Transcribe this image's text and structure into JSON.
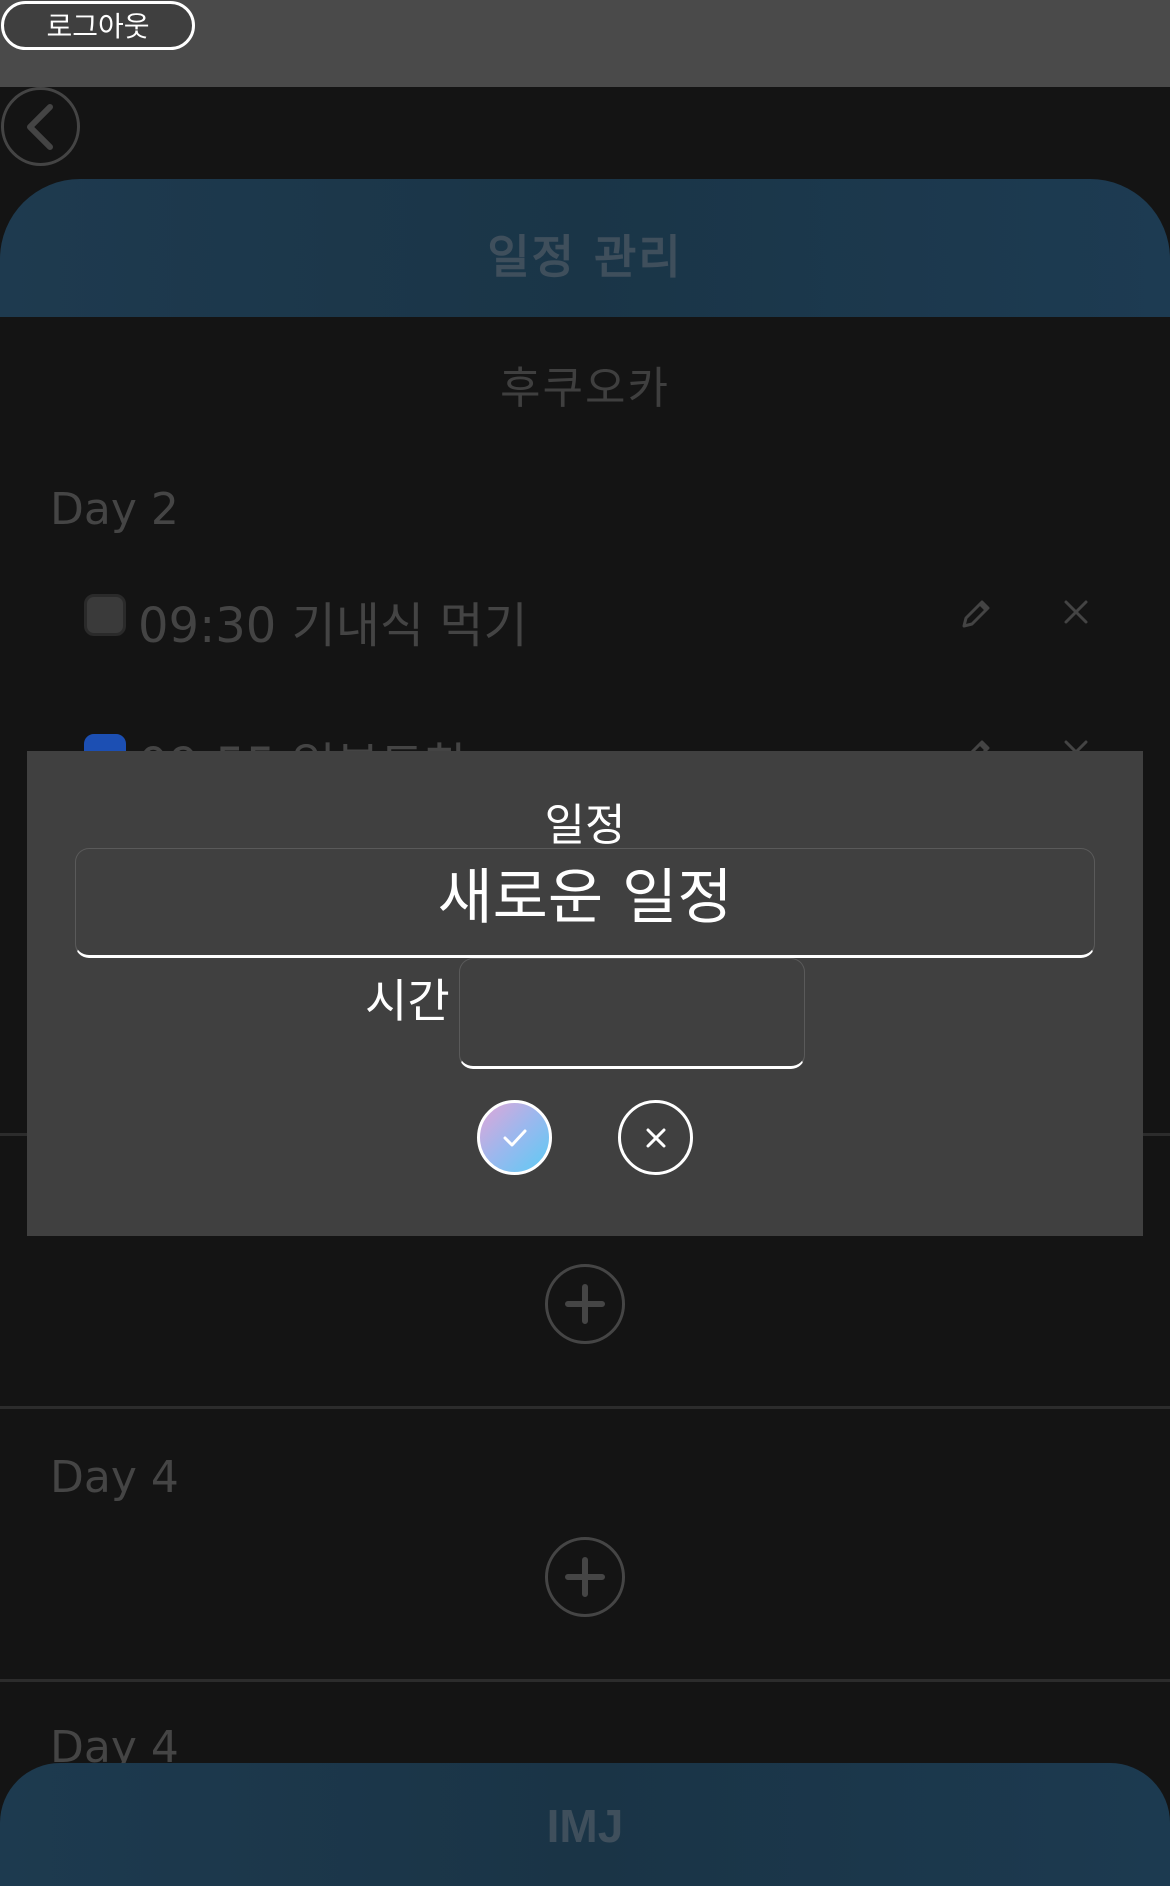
{
  "topbar": {
    "logout_label": "로그아웃"
  },
  "nav": {
    "back_icon": "chevron-left-icon"
  },
  "header": {
    "title": "일정 관리"
  },
  "trip": {
    "city": "후쿠오카"
  },
  "days": [
    {
      "label": "Day 2",
      "items": [
        {
          "text": "09:30 기내식 먹기",
          "checked": false
        },
        {
          "text": "09:55 일본도착",
          "checked": true
        }
      ]
    },
    {
      "label": "Day 4"
    },
    {
      "label": "Day 4"
    }
  ],
  "modal": {
    "event_label": "일정",
    "event_value": "새로운 일정",
    "time_label": "시간",
    "time_value": "",
    "confirm_icon": "check-icon",
    "cancel_icon": "close-icon"
  },
  "footer": {
    "brand": "IMJ"
  },
  "colors": {
    "header_gradient": "#1e3a4f",
    "checked_blue": "#1c4fb3",
    "confirm_gradient_start": "#e0a6d8",
    "confirm_gradient_end": "#5ccbf4"
  }
}
